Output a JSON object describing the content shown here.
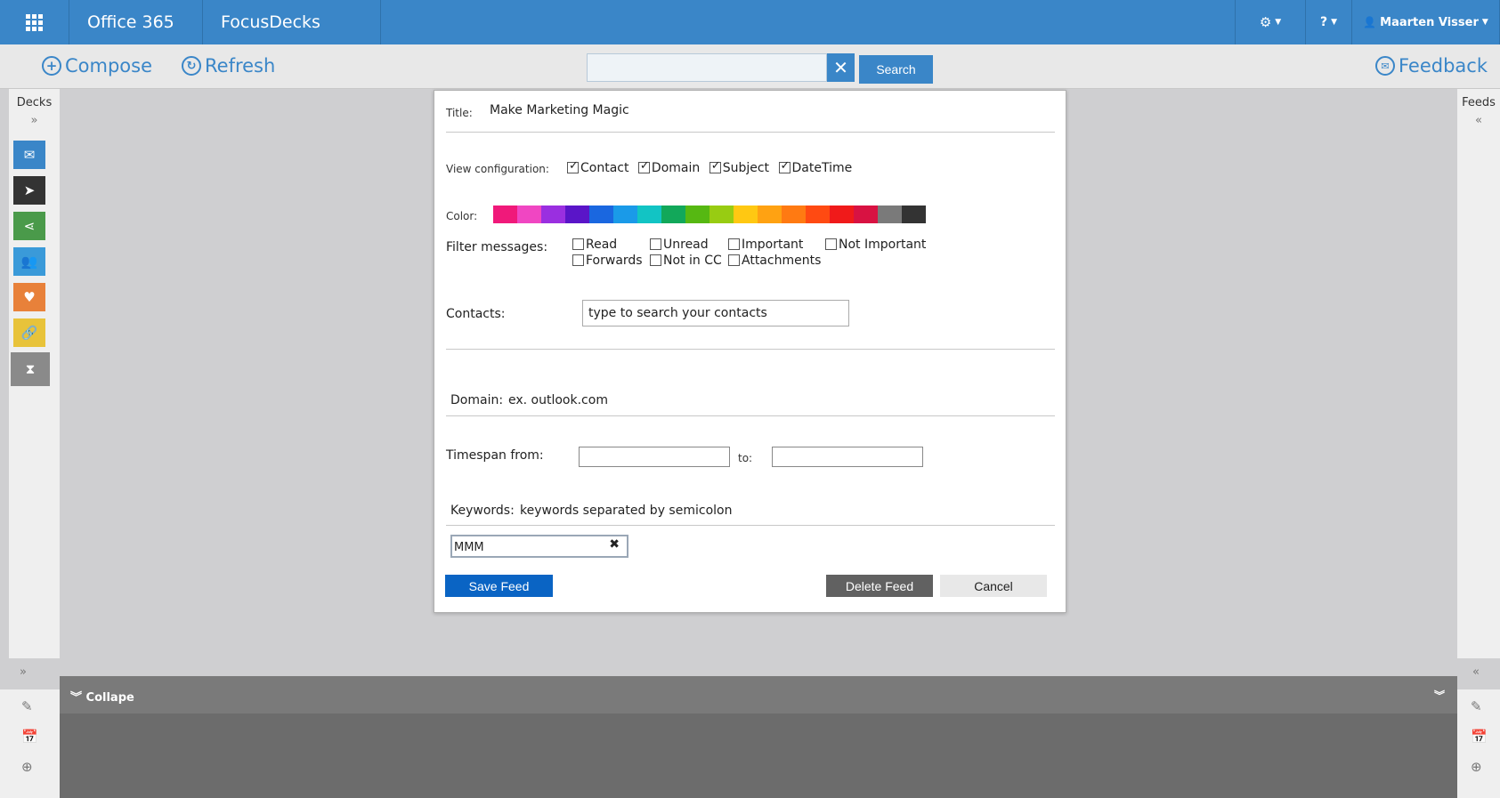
{
  "topbar": {
    "brand": "Office 365",
    "app_name": "FocusDecks",
    "help": "?",
    "user_name": "Maarten Visser"
  },
  "commandbar": {
    "compose": "Compose",
    "refresh": "Refresh",
    "search_value": "",
    "search_button": "Search",
    "feedback": "Feedback"
  },
  "decks": {
    "label": "Decks",
    "items": [
      {
        "icon": "envelope-icon",
        "color": "#3a86c8"
      },
      {
        "icon": "send-icon",
        "color": "#333333"
      },
      {
        "icon": "share-icon",
        "color": "#4a9a4a"
      },
      {
        "icon": "people-icon",
        "color": "#3a9ad9"
      },
      {
        "icon": "heart-icon",
        "color": "#e8813a"
      },
      {
        "icon": "link-icon",
        "color": "#e8c33a"
      },
      {
        "icon": "hourglass-icon",
        "color": "#8a8a8a"
      }
    ]
  },
  "feeds": {
    "label": "Feeds"
  },
  "collapse_bar": {
    "label": "Collape"
  },
  "dialog": {
    "title_label": "Title:",
    "title_value": "Make Marketing Magic",
    "view_config_label": "View configuration:",
    "view_config": [
      {
        "label": "Contact",
        "checked": true
      },
      {
        "label": "Domain",
        "checked": true
      },
      {
        "label": "Subject",
        "checked": true
      },
      {
        "label": "DateTime",
        "checked": true
      }
    ],
    "color_label": "Color:",
    "colors": [
      "#f0197a",
      "#f046c2",
      "#9a2fe0",
      "#5a15c8",
      "#1a67e0",
      "#1a9ae8",
      "#12c4c4",
      "#12a85a",
      "#56b812",
      "#98cc12",
      "#ffc812",
      "#ffa212",
      "#ff7a12",
      "#ff4a12",
      "#f01a1a",
      "#d81242",
      "#7a7a7a",
      "#333333"
    ],
    "filter_label": "Filter messages:",
    "filters": [
      "Read",
      "Unread",
      "Important",
      "Not Important",
      "Forwards",
      "Not in CC",
      "Attachments"
    ],
    "contacts_label": "Contacts:",
    "contacts_placeholder": "type to search your contacts",
    "domain_label": "Domain:",
    "domain_placeholder": "ex. outlook.com",
    "timespan_label": "Timespan from:",
    "timespan_to_label": "to:",
    "keywords_label": "Keywords:",
    "keywords_placeholder": "keywords separated by semicolon",
    "keyword_tag": "MMM",
    "save_button": "Save Feed",
    "delete_button": "Delete Feed",
    "cancel_button": "Cancel"
  }
}
